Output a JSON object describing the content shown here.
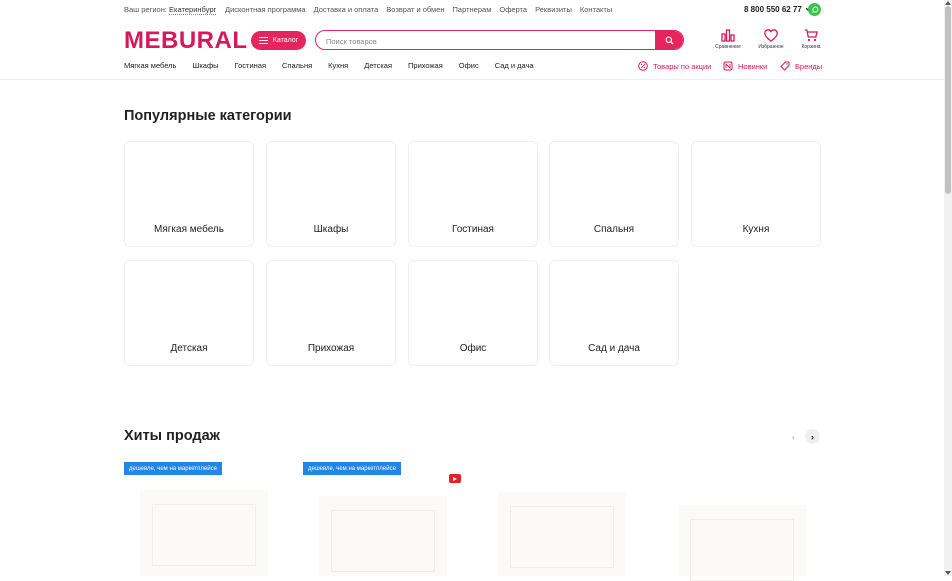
{
  "topbar": {
    "region_label": "Ваш регион:",
    "region_city": "Екатеринбург",
    "links": [
      "Дисконтная программа",
      "Доставка и оплата",
      "Возврат и обмен",
      "Партнерам",
      "Оферта",
      "Реквизиты",
      "Контакты"
    ],
    "phone": "8 800 550 62 77"
  },
  "header": {
    "logo": "MEBURAL",
    "catalog_label": "Каталог",
    "search_placeholder": "Поиск товаров",
    "icons": [
      {
        "name": "compare-icon",
        "label": "Сравнение"
      },
      {
        "name": "heart-icon",
        "label": "Избранное"
      },
      {
        "name": "cart-icon",
        "label": "Корзина"
      }
    ]
  },
  "nav": {
    "items": [
      "Мягкая мебель",
      "Шкафы",
      "Гостиная",
      "Спальня",
      "Кухня",
      "Детская",
      "Прихожая",
      "Офис",
      "Сад и дача"
    ],
    "promo": [
      {
        "label": "Товары по акции",
        "icon": "percent-icon"
      },
      {
        "label": "Новинки",
        "icon": "new-icon"
      },
      {
        "label": "Бренды",
        "icon": "tag-icon"
      }
    ]
  },
  "popular": {
    "title": "Популярные категории",
    "categories": [
      "Мягкая мебель",
      "Шкафы",
      "Гостиная",
      "Спальня",
      "Кухня",
      "Детская",
      "Прихожая",
      "Офис",
      "Сад и дача"
    ]
  },
  "hits": {
    "title": "Хиты продаж",
    "badge": "дешевле, чем на маркетплейсе"
  },
  "colors": {
    "brand": "#d5195b",
    "accent": "#e5265e",
    "badge": "#2186e8",
    "whatsapp": "#3cc24f"
  }
}
